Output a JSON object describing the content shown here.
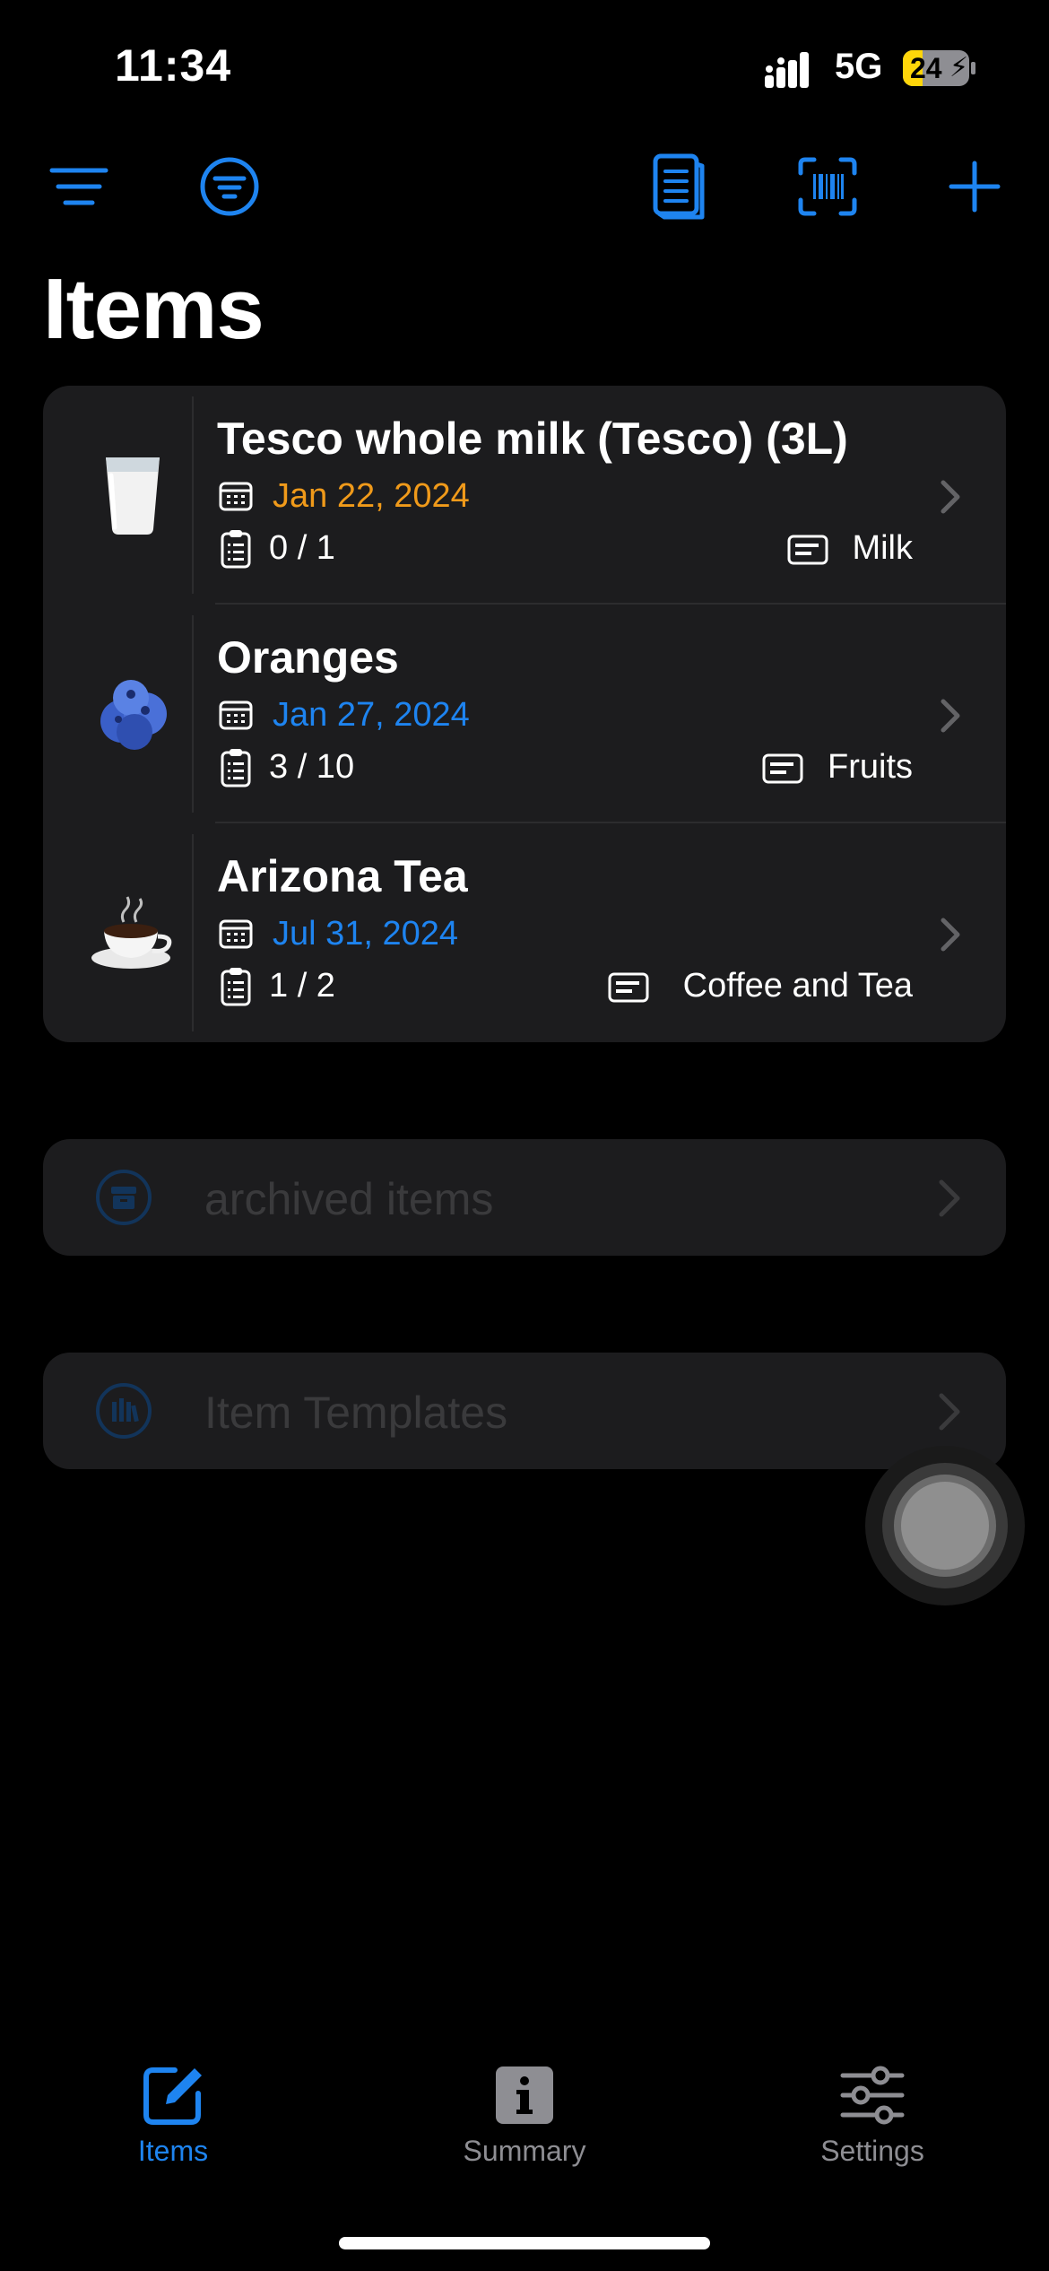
{
  "status_bar": {
    "time": "11:34",
    "network": "5G",
    "battery": "24"
  },
  "toolbar": {
    "icons": [
      "sort-lines-icon",
      "filter-circle-icon",
      "book-icon",
      "barcode-scan-icon",
      "plus-icon"
    ]
  },
  "page_title": "Items",
  "items": [
    {
      "emoji": "🥛",
      "name": "Tesco whole milk (Tesco) (3L)",
      "date": "Jan 22, 2024",
      "date_color": "#f09a1a",
      "quantity": "0 / 1",
      "category": "Milk"
    },
    {
      "emoji": "🫐",
      "name": "Oranges",
      "date": "Jan 27, 2024",
      "date_color": "#1e84f0",
      "quantity": "3 / 10",
      "category": "Fruits"
    },
    {
      "emoji": "☕",
      "name": "Arizona Tea",
      "date": "Jul 31, 2024",
      "date_color": "#1e84f0",
      "quantity": "1 / 2",
      "category": "Coffee and Tea"
    }
  ],
  "archived_label": "archived items",
  "templates_label": "Item Templates",
  "tabs": [
    {
      "label": "Items",
      "icon": "square-pencil-icon",
      "active": true
    },
    {
      "label": "Summary",
      "icon": "info-square-icon",
      "active": false
    },
    {
      "label": "Settings",
      "icon": "sliders-icon",
      "active": false
    }
  ],
  "colors": {
    "accent": "#1e84f0",
    "card": "#1c1c1e",
    "inactive": "#8e8e93"
  }
}
